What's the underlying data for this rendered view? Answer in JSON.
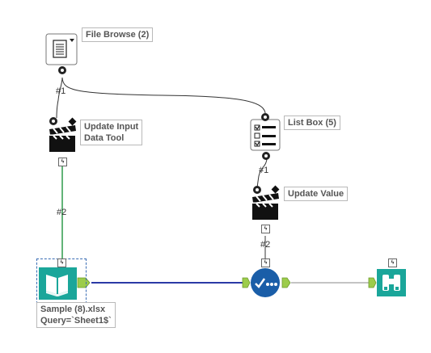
{
  "canvas": {
    "background": "#ffffff"
  },
  "tools": {
    "file_browse": {
      "label": "File Browse (2)",
      "icon": "document-icon"
    },
    "update_input": {
      "label": "Update Input\nData Tool",
      "icon": "clapperboard-icon"
    },
    "list_box": {
      "label": "List Box (5)",
      "icon": "checklist-icon"
    },
    "update_value": {
      "label": "Update Value",
      "icon": "clapperboard-icon"
    },
    "input_data": {
      "label": "Sample (8).xlsx\nQuery=`Sheet1$`",
      "icon": "open-book-icon"
    },
    "action": {
      "icon": "check-action-icon"
    },
    "browse": {
      "icon": "binoculars-icon"
    }
  },
  "connections": {
    "fb_to_update_input": "#1",
    "update_input_to_input": "#2",
    "listbox_to_update_value": "#1",
    "update_value_to_action": "#2"
  },
  "colors": {
    "connection_green": "#2e9a4a",
    "connection_blue": "#2b3aa6",
    "connection_gray": "#888888",
    "teal": "#1aa69a",
    "action_blue": "#1a5ea8",
    "anchor_green": "#9ccc4a"
  }
}
